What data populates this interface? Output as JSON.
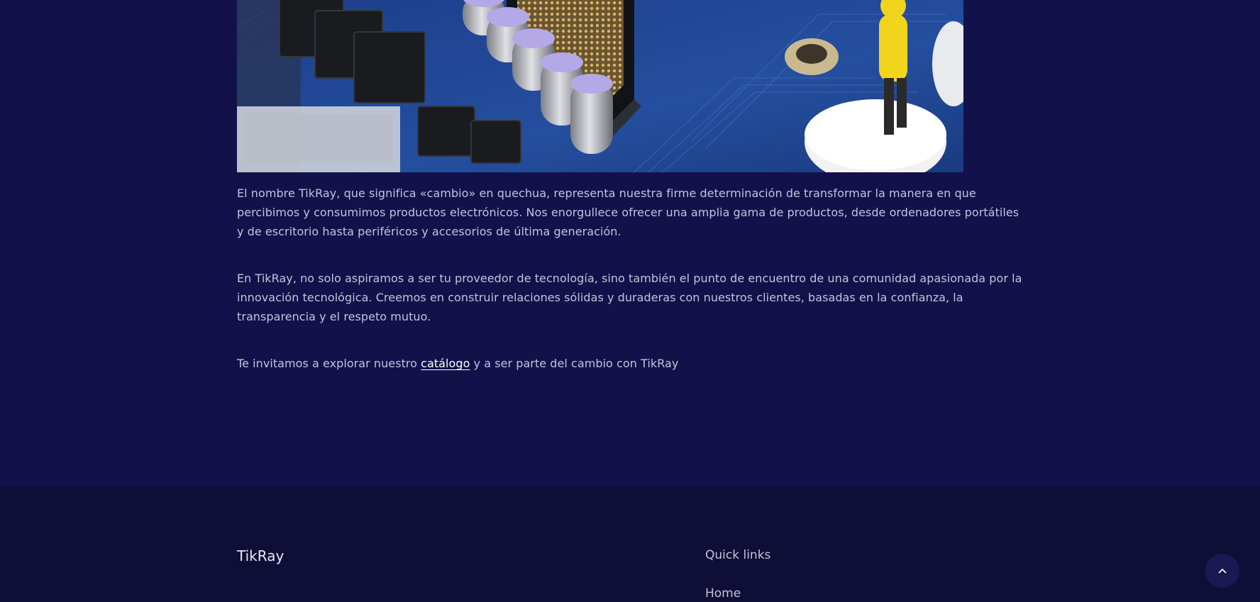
{
  "about": {
    "paragraph1": "El nombre TikRay, que significa «cambio» en quechua, representa nuestra firme determinación de transformar la manera en que percibimos y consumimos productos electrónicos. Nos enorgullece ofrecer una amplia gama de productos, desde ordenadores portátiles y de escritorio hasta periféricos y accesorios de última generación.",
    "paragraph2": "En TikRay, no solo aspiramos a ser tu proveedor de tecnología, sino también el punto de encuentro de una comunidad apasionada por la innovación tecnológica. Creemos en construir relaciones sólidas y duraderas con nuestros clientes, basadas en la confianza, la transparencia y el respeto mutuo.",
    "invite_before": "Te invitamos a explorar nuestro ",
    "invite_link": "catálogo",
    "invite_after": " y a ser parte del cambio con TikRay"
  },
  "footer": {
    "brand": "TikRay",
    "quick_links_title": "Quick links",
    "links": [
      "Home"
    ]
  },
  "icons": {
    "hero_image": "motherboard-photo",
    "back_to_top": "chevron-up-icon"
  },
  "colors": {
    "page_background": "#13114a",
    "footer_background": "#0f0e36",
    "text": "#c4c3d9",
    "link": "#ffffff"
  }
}
